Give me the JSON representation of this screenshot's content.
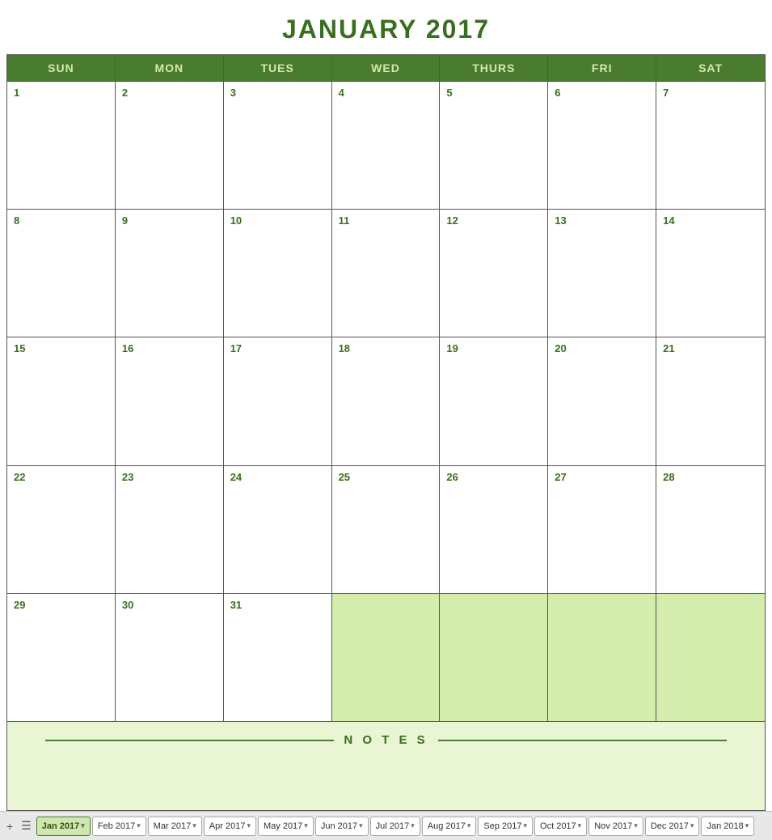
{
  "title": "JANUARY 2017",
  "headers": [
    "SUN",
    "MON",
    "TUES",
    "WED",
    "THURS",
    "FRI",
    "SAT"
  ],
  "weeks": [
    [
      {
        "num": "1",
        "next": false
      },
      {
        "num": "2",
        "next": false
      },
      {
        "num": "3",
        "next": false
      },
      {
        "num": "4",
        "next": false
      },
      {
        "num": "5",
        "next": false
      },
      {
        "num": "6",
        "next": false
      },
      {
        "num": "7",
        "next": false
      }
    ],
    [
      {
        "num": "8",
        "next": false
      },
      {
        "num": "9",
        "next": false
      },
      {
        "num": "10",
        "next": false
      },
      {
        "num": "11",
        "next": false
      },
      {
        "num": "12",
        "next": false
      },
      {
        "num": "13",
        "next": false
      },
      {
        "num": "14",
        "next": false
      }
    ],
    [
      {
        "num": "15",
        "next": false
      },
      {
        "num": "16",
        "next": false
      },
      {
        "num": "17",
        "next": false
      },
      {
        "num": "18",
        "next": false
      },
      {
        "num": "19",
        "next": false
      },
      {
        "num": "20",
        "next": false
      },
      {
        "num": "21",
        "next": false
      }
    ],
    [
      {
        "num": "22",
        "next": false
      },
      {
        "num": "23",
        "next": false
      },
      {
        "num": "24",
        "next": false
      },
      {
        "num": "25",
        "next": false
      },
      {
        "num": "26",
        "next": false
      },
      {
        "num": "27",
        "next": false
      },
      {
        "num": "28",
        "next": false
      }
    ],
    [
      {
        "num": "29",
        "next": false
      },
      {
        "num": "30",
        "next": false
      },
      {
        "num": "31",
        "next": false
      },
      {
        "num": "",
        "next": true
      },
      {
        "num": "",
        "next": true
      },
      {
        "num": "",
        "next": true
      },
      {
        "num": "",
        "next": true
      }
    ]
  ],
  "notes_label": "N O T E S",
  "tabs": [
    {
      "label": "Jan 2017",
      "active": true
    },
    {
      "label": "Feb 2017",
      "active": false
    },
    {
      "label": "Mar 2017",
      "active": false
    },
    {
      "label": "Apr 2017",
      "active": false
    },
    {
      "label": "May 2017",
      "active": false
    },
    {
      "label": "Jun 2017",
      "active": false
    },
    {
      "label": "Jul 2017",
      "active": false
    },
    {
      "label": "Aug 2017",
      "active": false
    },
    {
      "label": "Sep 2017",
      "active": false
    },
    {
      "label": "Oct 2017",
      "active": false
    },
    {
      "label": "Nov 2017",
      "active": false
    },
    {
      "label": "Dec 2017",
      "active": false
    },
    {
      "label": "Jan 2018",
      "active": false
    }
  ]
}
